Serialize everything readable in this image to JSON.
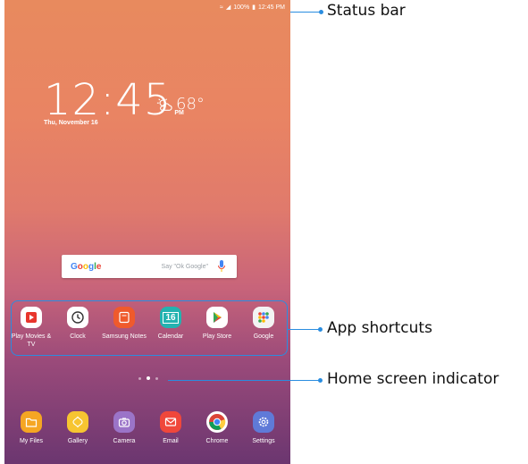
{
  "status_bar": {
    "battery": "100%",
    "time": "12:45 PM"
  },
  "clock": {
    "time": "12:45",
    "ampm": "PM",
    "date": "Thu, November 16"
  },
  "weather": {
    "temp": "68°",
    "icon": "partly-sunny-icon"
  },
  "search": {
    "logo": "Google",
    "hint": "Say \"Ok Google\""
  },
  "app_shortcuts": [
    {
      "label": "Play Movies & TV",
      "icon": "play-movies-icon",
      "color": "#ff3d3d"
    },
    {
      "label": "Clock",
      "icon": "clock-icon",
      "color": "#ffffff"
    },
    {
      "label": "Samsung Notes",
      "icon": "samsung-notes-icon",
      "color": "#f0602a"
    },
    {
      "label": "Calendar",
      "icon": "calendar-icon",
      "color": "#2fb6b4"
    },
    {
      "label": "Play Store",
      "icon": "play-store-icon",
      "color": "#ffffff"
    },
    {
      "label": "Google",
      "icon": "google-folder-icon",
      "color": "#f2f2f2"
    }
  ],
  "dock": [
    {
      "label": "My Files",
      "icon": "my-files-icon",
      "color": "#f5a623"
    },
    {
      "label": "Gallery",
      "icon": "gallery-icon",
      "color": "#f7c531"
    },
    {
      "label": "Camera",
      "icon": "camera-icon",
      "color": "#9b74c8"
    },
    {
      "label": "Email",
      "icon": "email-icon",
      "color": "#f0473b"
    },
    {
      "label": "Chrome",
      "icon": "chrome-icon",
      "color": "#ffffff"
    },
    {
      "label": "Settings",
      "icon": "settings-icon",
      "color": "#5f7ad8"
    }
  ],
  "callouts": {
    "status_bar": "Status bar",
    "app_shortcuts": "App shortcuts",
    "home_indicator": "Home screen indicator"
  },
  "colors": {
    "accent": "#2a8de0"
  }
}
